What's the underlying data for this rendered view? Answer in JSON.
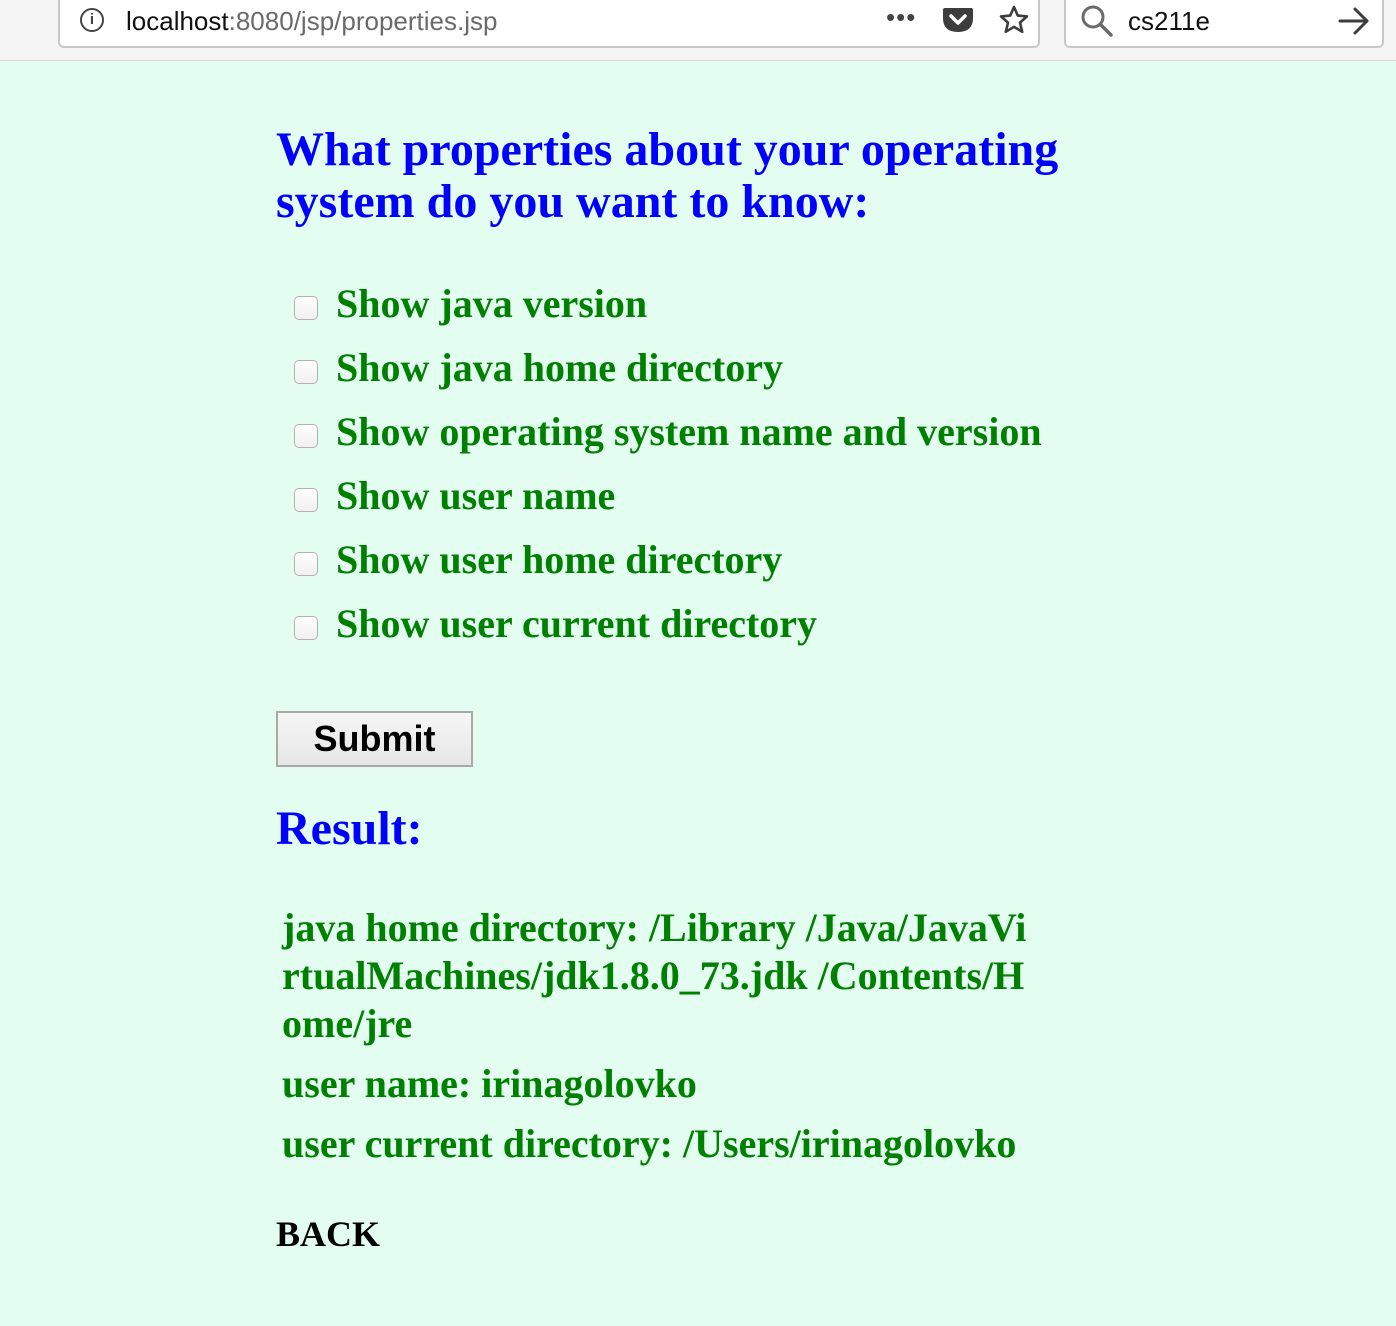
{
  "browser": {
    "url_host": "localhost",
    "url_path": ":8080/jsp/properties.jsp",
    "search_value": "cs211e",
    "menu_dots": "•••",
    "info_icon_glyph": "i"
  },
  "form": {
    "heading": "What properties about your operating system do you want to know:",
    "options": [
      {
        "label": "Show java version",
        "checked": false
      },
      {
        "label": "Show java home directory",
        "checked": false
      },
      {
        "label": "Show operating system name and version",
        "checked": false
      },
      {
        "label": "Show user name",
        "checked": false
      },
      {
        "label": "Show user home directory",
        "checked": false
      },
      {
        "label": "Show user current directory",
        "checked": false
      }
    ],
    "submit_label": "Submit"
  },
  "result": {
    "heading": "Result:",
    "lines": [
      "java home directory: /Library /Java/JavaVirtualMachines/jdk1.8.0_73.jdk /Contents/Home/jre",
      "user name: irinagolovko",
      "user current directory: /Users/irinagolovko"
    ]
  },
  "back_label": "BACK",
  "colors": {
    "background": "#e3fdf1",
    "heading": "#0000ff",
    "text": "#008000"
  }
}
